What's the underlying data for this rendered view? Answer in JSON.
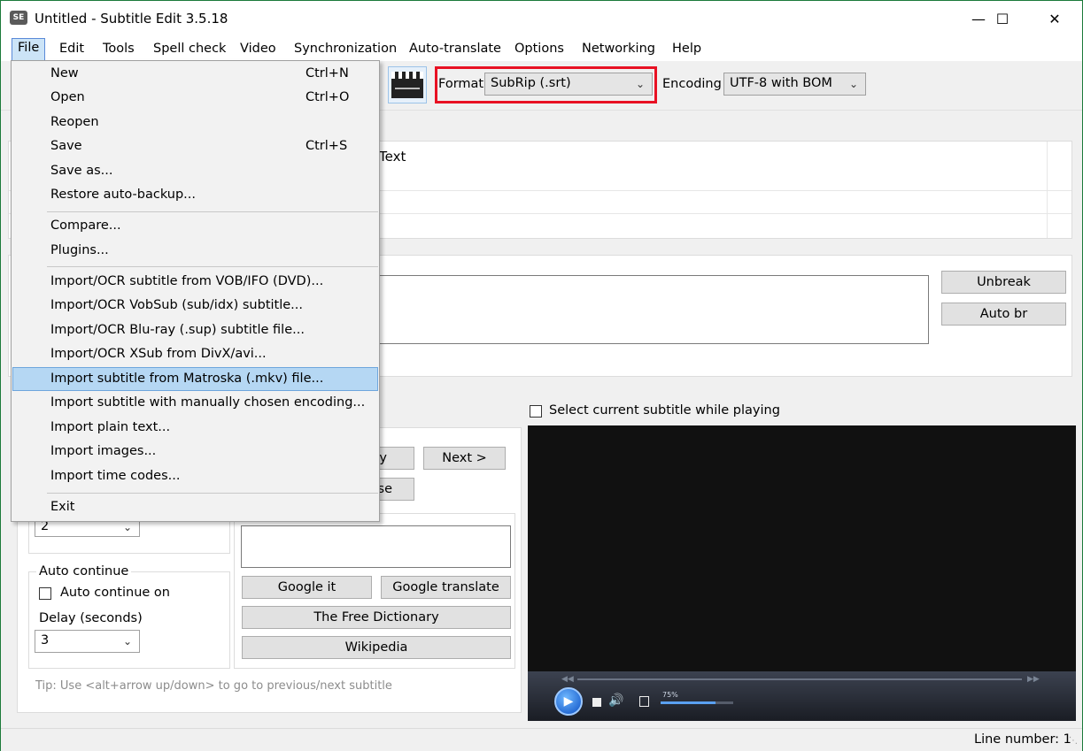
{
  "window": {
    "title": "Untitled - Subtitle Edit 3.5.18",
    "app_icon_text": "SE",
    "minimize": "—",
    "maximize": "☐",
    "close": "✕"
  },
  "menubar": [
    "File",
    "Edit",
    "Tools",
    "Spell check",
    "Video",
    "Synchronization",
    "Auto-translate",
    "Options",
    "Networking",
    "Help"
  ],
  "toolbar": {
    "format_label": "Format",
    "format_value": "SubRip (.srt)",
    "encoding_label": "Encoding",
    "encoding_value": "UTF-8 with BOM",
    "highlight_color": "#e81123"
  },
  "subtitle_list": {
    "column_text": "Text"
  },
  "edit_area": {
    "unbreak": "Unbreak",
    "auto_br": "Auto br"
  },
  "left_panel": {
    "next_button": "Next >",
    "partial_button_1": "y",
    "partial_button_2": "se",
    "repeat_count_value": "2",
    "auto_continue_title": "Auto continue",
    "auto_continue_on": "Auto continue on",
    "delay_label": "Delay (seconds)",
    "delay_value": "3",
    "google_it": "Google it",
    "google_translate": "Google translate",
    "free_dictionary": "The Free Dictionary",
    "wikipedia": "Wikipedia",
    "tip": "Tip: Use <alt+arrow up/down> to go to previous/next subtitle"
  },
  "video": {
    "select_current": "Select current subtitle while playing",
    "volume_percent": "75%",
    "volume_level": 0.75
  },
  "status": {
    "line_number": "Line number: 1"
  },
  "file_menu": {
    "items": [
      {
        "label": "New",
        "shortcut": "Ctrl+N"
      },
      {
        "label": "Open",
        "shortcut": "Ctrl+O"
      },
      {
        "label": "Reopen",
        "shortcut": ""
      },
      {
        "label": "Save",
        "shortcut": "Ctrl+S"
      },
      {
        "label": "Save as...",
        "shortcut": ""
      },
      {
        "label": "Restore auto-backup...",
        "shortcut": ""
      },
      {
        "label": "Compare...",
        "shortcut": ""
      },
      {
        "label": "Plugins...",
        "shortcut": ""
      },
      {
        "label": "Import/OCR subtitle from VOB/IFO (DVD)...",
        "shortcut": ""
      },
      {
        "label": "Import/OCR VobSub (sub/idx) subtitle...",
        "shortcut": ""
      },
      {
        "label": "Import/OCR Blu-ray (.sup) subtitle file...",
        "shortcut": ""
      },
      {
        "label": "Import/OCR XSub from DivX/avi...",
        "shortcut": ""
      },
      {
        "label": "Import subtitle from Matroska (.mkv) file...",
        "shortcut": ""
      },
      {
        "label": "Import subtitle with manually chosen encoding...",
        "shortcut": ""
      },
      {
        "label": "Import plain text...",
        "shortcut": ""
      },
      {
        "label": "Import images...",
        "shortcut": ""
      },
      {
        "label": "Import time codes...",
        "shortcut": ""
      },
      {
        "label": "Exit",
        "shortcut": ""
      }
    ]
  }
}
